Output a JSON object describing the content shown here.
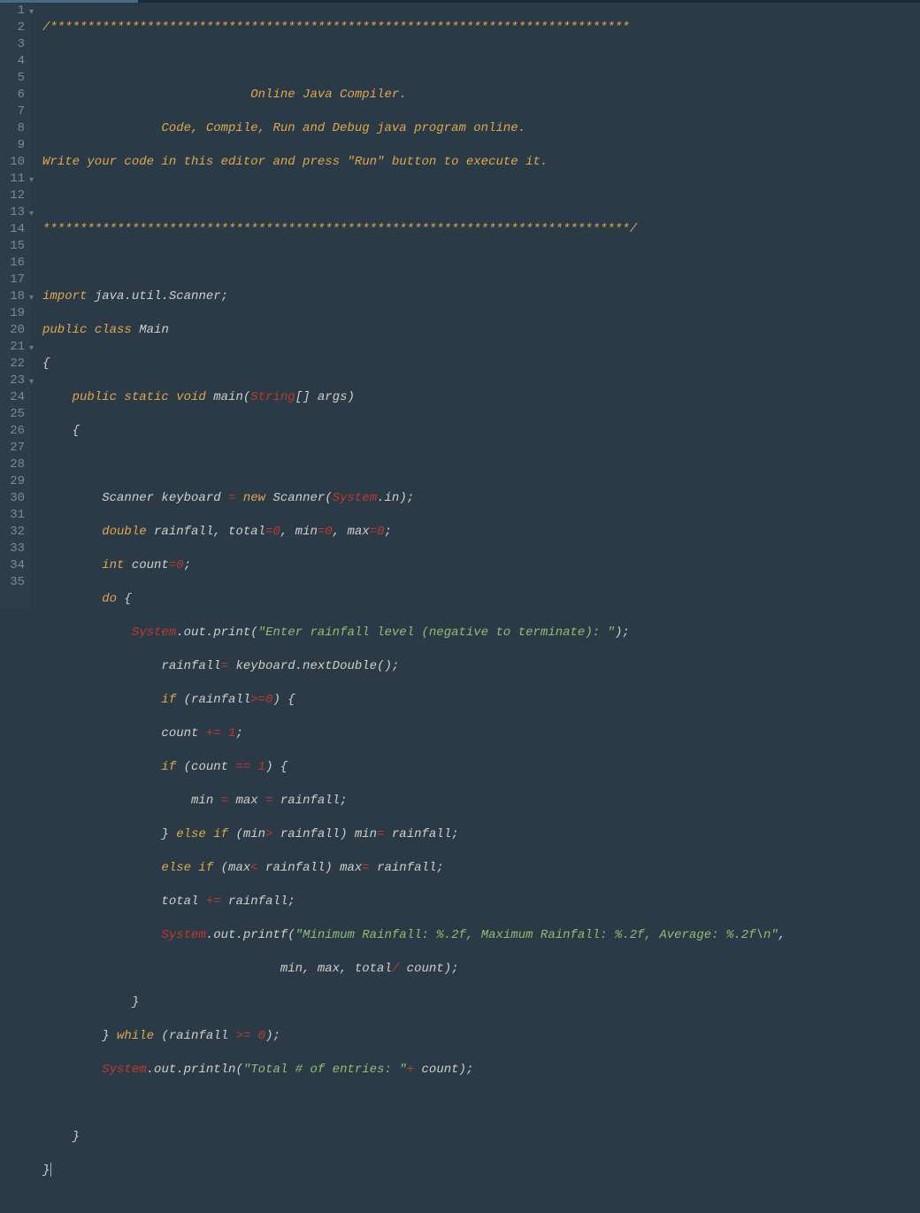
{
  "lineNumbers": [
    "1",
    "2",
    "3",
    "4",
    "5",
    "6",
    "7",
    "8",
    "9",
    "10",
    "11",
    "12",
    "13",
    "14",
    "15",
    "16",
    "17",
    "18",
    "19",
    "20",
    "21",
    "22",
    "23",
    "24",
    "25",
    "26",
    "27",
    "28",
    "29",
    "30",
    "31",
    "32",
    "33",
    "34",
    "35"
  ],
  "foldLines": [
    1,
    11,
    13,
    18,
    21,
    23
  ],
  "code": {
    "l1": "/******************************************************************************",
    "l2": "",
    "l3": "                            Online Java Compiler.",
    "l4": "                Code, Compile, Run and Debug java program online.",
    "l5": "Write your code in this editor and press \"Run\" button to execute it.",
    "l6": "",
    "l7": "*******************************************************************************/",
    "l8": "",
    "l9_import": "import",
    "l9_pkg": " java.util.Scanner;",
    "l10_public": "public",
    "l10_class": " class",
    "l10_name": " Main",
    "l11": "{",
    "l12_mods": "    public static void",
    "l12_main": " main",
    "l12_po": "(",
    "l12_str": "String",
    "l12_args": "[] args)",
    "l13": "    {",
    "l14": "        ",
    "l15a": "        Scanner keyboard ",
    "l15eq": "=",
    "l15new": " new",
    "l15b": " Scanner(",
    "l15sys": "System",
    "l15in": ".in);",
    "l16a": "        double",
    "l16b": " rainfall, total",
    "l16eq1": "=",
    "l16n1": "0",
    "l16c": ", min",
    "l16eq2": "=",
    "l16n2": "0",
    "l16d": ", max",
    "l16eq3": "=",
    "l16n3": "0",
    "l16e": ";",
    "l17a": "        int",
    "l17b": " count",
    "l17eq": "=",
    "l17n": "0",
    "l17c": ";",
    "l18a": "        do",
    "l18b": " {",
    "l19pad": "            ",
    "l19sys": "System",
    "l19a": ".out.print(",
    "l19str": "\"Enter rainfall level (negative to terminate): \"",
    "l19b": ");",
    "l20pad": "                rainfall",
    "l20eq": "=",
    "l20b": " keyboard.nextDouble();",
    "l21a": "                if",
    "l21b": " (rainfall",
    "l21op": ">=",
    "l21n": "0",
    "l21c": ") {",
    "l22a": "                count ",
    "l22op": "+=",
    "l22sp": " ",
    "l22n": "1",
    "l22b": ";",
    "l23a": "                if",
    "l23b": " (count ",
    "l23op": "==",
    "l23sp": " ",
    "l23n": "1",
    "l23c": ") {",
    "l24a": "                    min ",
    "l24eq": "=",
    "l24b": " max ",
    "l24eq2": "=",
    "l24c": " rainfall;",
    "l25a": "                } ",
    "l25else": "else if",
    "l25b": " (min",
    "l25op": ">",
    "l25c": " rainfall) min",
    "l25eq": "=",
    "l25d": " rainfall;",
    "l26a": "                ",
    "l26else": "else if",
    "l26b": " (max",
    "l26op": "<",
    "l26c": " rainfall) max",
    "l26eq": "=",
    "l26d": " rainfall;",
    "l27a": "                total ",
    "l27op": "+=",
    "l27b": " rainfall;",
    "l28pad": "                ",
    "l28sys": "System",
    "l28a": ".out.printf(",
    "l28str": "\"Minimum Rainfall: %.2f, Maximum Rainfall: %.2f, Average: %.2f\\n\"",
    "l28b": ",",
    "l29a": "                                min, max, total",
    "l29op": "/",
    "l29b": " count);",
    "l30": "            }",
    "l31a": "        } ",
    "l31while": "while",
    "l31b": " (rainfall ",
    "l31op": ">=",
    "l31sp": " ",
    "l31n": "0",
    "l31c": ");",
    "l32pad": "        ",
    "l32sys": "System",
    "l32a": ".out.println(",
    "l32str": "\"Total # of entries: \"",
    "l32op": "+",
    "l32b": " count);",
    "l33": "        ",
    "l34": "    }",
    "l35": "}"
  }
}
